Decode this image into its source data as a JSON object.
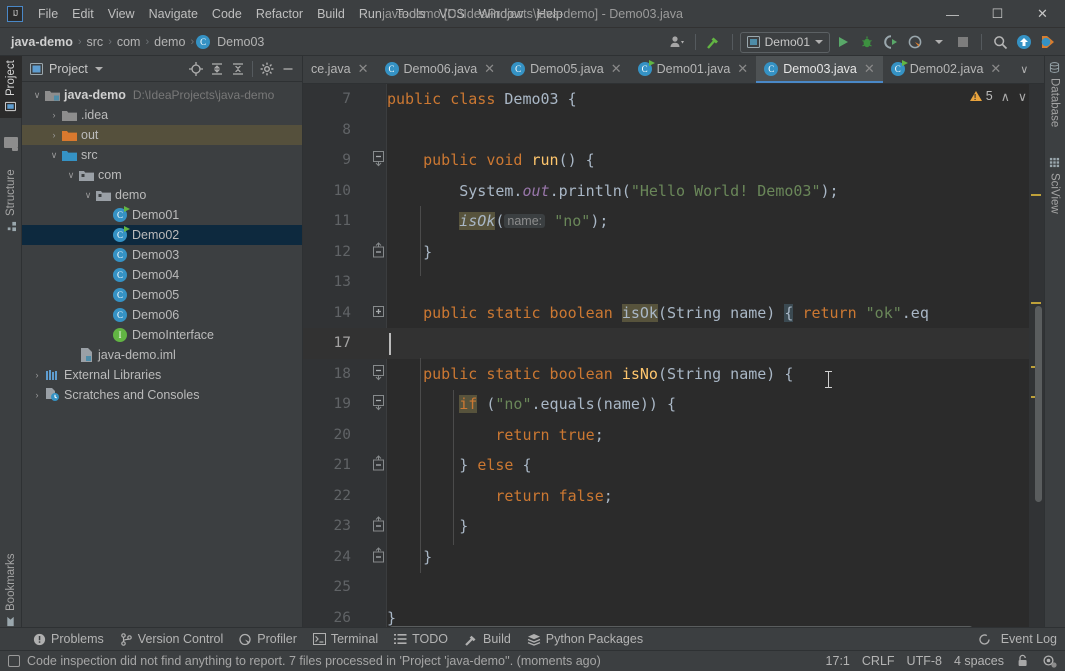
{
  "window": {
    "title": "java-demo [D:\\IdeaProjects\\java-demo] - Demo03.java",
    "logo": "intellij-idea-logo",
    "minimize": "—",
    "maximize": "☐",
    "close": "✕"
  },
  "menu": {
    "items": [
      "File",
      "Edit",
      "View",
      "Navigate",
      "Code",
      "Refactor",
      "Build",
      "Run",
      "Tools",
      "VCS",
      "Window",
      "Help"
    ]
  },
  "breadcrumb": {
    "items": [
      "java-demo",
      "src",
      "com",
      "demo",
      "Demo03"
    ],
    "separator": "›"
  },
  "toolbar": {
    "run_config": "Demo01",
    "icons": [
      "user-avatar-icon",
      "build-hammer-icon",
      "run-icon",
      "debug-icon",
      "run-with-coverage-icon",
      "profiler-icon",
      "stop-icon",
      "search-everywhere-icon",
      "update-project-icon",
      "git-push-icon"
    ]
  },
  "left_tool_strip": {
    "top": [
      {
        "label": "Project",
        "icon": "project-icon",
        "active": true
      },
      {
        "label": "Structure",
        "icon": "structure-icon",
        "active": false
      }
    ],
    "bottom": [
      {
        "label": "Bookmarks",
        "icon": "bookmark-icon",
        "active": false
      }
    ]
  },
  "right_tool_strip": {
    "items": [
      {
        "label": "Database",
        "icon": "database-icon"
      },
      {
        "label": "SciView",
        "icon": "sciview-icon"
      }
    ]
  },
  "project_panel": {
    "title": "Project",
    "tools": [
      "locate-icon",
      "expand-all-icon",
      "collapse-all-icon",
      "settings-gear-icon",
      "hide-panel-icon"
    ],
    "tree": [
      {
        "depth": 0,
        "twist": "∨",
        "icon": "module-folder-icon",
        "label": "java-demo",
        "sub": "D:\\IdeaProjects\\java-demo",
        "bold": true,
        "state": "normal"
      },
      {
        "depth": 1,
        "twist": "›",
        "icon": "folder-gray-icon",
        "label": ".idea",
        "sub": "",
        "bold": false,
        "state": "normal"
      },
      {
        "depth": 1,
        "twist": "›",
        "icon": "folder-orange-icon",
        "label": "out",
        "sub": "",
        "bold": false,
        "state": "highlight"
      },
      {
        "depth": 1,
        "twist": "∨",
        "icon": "folder-source-icon",
        "label": "src",
        "sub": "",
        "bold": false,
        "state": "normal"
      },
      {
        "depth": 2,
        "twist": "∨",
        "icon": "package-icon",
        "label": "com",
        "sub": "",
        "bold": false,
        "state": "normal"
      },
      {
        "depth": 3,
        "twist": "∨",
        "icon": "package-icon",
        "label": "demo",
        "sub": "",
        "bold": false,
        "state": "normal"
      },
      {
        "depth": 4,
        "twist": "",
        "icon": "java-class-runnable-icon",
        "label": "Demo01",
        "sub": "",
        "bold": false,
        "state": "normal"
      },
      {
        "depth": 4,
        "twist": "",
        "icon": "java-class-runnable-icon",
        "label": "Demo02",
        "sub": "",
        "bold": false,
        "state": "selected"
      },
      {
        "depth": 4,
        "twist": "",
        "icon": "java-class-icon",
        "label": "Demo03",
        "sub": "",
        "bold": false,
        "state": "normal"
      },
      {
        "depth": 4,
        "twist": "",
        "icon": "java-class-icon",
        "label": "Demo04",
        "sub": "",
        "bold": false,
        "state": "normal"
      },
      {
        "depth": 4,
        "twist": "",
        "icon": "java-class-icon",
        "label": "Demo05",
        "sub": "",
        "bold": false,
        "state": "normal"
      },
      {
        "depth": 4,
        "twist": "",
        "icon": "java-class-icon",
        "label": "Demo06",
        "sub": "",
        "bold": false,
        "state": "normal"
      },
      {
        "depth": 4,
        "twist": "",
        "icon": "java-interface-icon",
        "label": "DemoInterface",
        "sub": "",
        "bold": false,
        "state": "normal"
      },
      {
        "depth": 2,
        "twist": "",
        "icon": "iml-file-icon",
        "label": "java-demo.iml",
        "sub": "",
        "bold": false,
        "state": "normal"
      },
      {
        "depth": 0,
        "twist": "›",
        "icon": "external-libraries-icon",
        "label": "External Libraries",
        "sub": "",
        "bold": false,
        "state": "normal"
      },
      {
        "depth": 0,
        "twist": "›",
        "icon": "scratches-icon",
        "label": "Scratches and Consoles",
        "sub": "",
        "bold": false,
        "state": "normal"
      }
    ]
  },
  "editor_tabs": {
    "items": [
      {
        "label": "ce.java",
        "icon": "java-interface-icon",
        "active": false,
        "truncated": true
      },
      {
        "label": "Demo06.java",
        "icon": "java-class-icon",
        "active": false,
        "truncated": false
      },
      {
        "label": "Demo05.java",
        "icon": "java-class-icon",
        "active": false,
        "truncated": false
      },
      {
        "label": "Demo01.java",
        "icon": "java-class-runnable-icon",
        "active": false,
        "truncated": false
      },
      {
        "label": "Demo03.java",
        "icon": "java-class-icon",
        "active": true,
        "truncated": false
      },
      {
        "label": "Demo02.java",
        "icon": "java-class-runnable-icon",
        "active": false,
        "truncated": false
      }
    ],
    "close_glyph": "✕",
    "overflow_icon": "chevron-down-icon",
    "more_icon": "more-options-icon"
  },
  "editor": {
    "inspection_count": "5",
    "inspection_icon": "warning-triangle-icon",
    "prev_icon": "∧",
    "next_icon": "∨",
    "caret_position": "17:1",
    "lines": [
      {
        "num": "7",
        "fold": "",
        "current": false,
        "html": "<span class=\"kw\">public class</span> <span class=\"cls\">Demo03</span> {"
      },
      {
        "num": "8",
        "fold": "",
        "current": false,
        "html": ""
      },
      {
        "num": "9",
        "fold": "minus",
        "current": false,
        "html": "    <span class=\"kw\">public void</span> <span class=\"meth\">run</span>() {"
      },
      {
        "num": "10",
        "fold": "",
        "current": false,
        "html": "        System.<span class=\"fld\">out</span>.println(<span class=\"str\">\"Hello World! Demo03\"</span>);"
      },
      {
        "num": "11",
        "fold": "",
        "current": false,
        "html": "        <span class=\"usage-hl ident-it\">isOk</span>(<span class=\"hint\">name:</span> <span class=\"str\">\"no\"</span>);"
      },
      {
        "num": "12",
        "fold": "end",
        "current": false,
        "html": "    }"
      },
      {
        "num": "13",
        "fold": "",
        "current": false,
        "html": ""
      },
      {
        "num": "14",
        "fold": "plus",
        "current": false,
        "html": "    <span class=\"kw\">public static boolean</span> <span class=\"usage-hl\">isOk</span>(<span class=\"cls\">String</span> name) <span class=\"brace-hl\">{</span> <span class=\"kw\">return</span> <span class=\"str\">\"ok\"</span>.eq"
      },
      {
        "num": "17",
        "fold": "",
        "current": true,
        "html": ""
      },
      {
        "num": "18",
        "fold": "minus",
        "current": false,
        "html": "    <span class=\"kw\">public static boolean</span> <span class=\"meth\">isNo</span>(<span class=\"cls\">String</span> name) {"
      },
      {
        "num": "19",
        "fold": "minus",
        "current": false,
        "html": "        <span class=\"usage-hl\"><span class=\"kw\">if</span></span> (<span class=\"str\">\"no\"</span>.equals(name)) {"
      },
      {
        "num": "20",
        "fold": "",
        "current": false,
        "html": "            <span class=\"kw\">return true</span>;"
      },
      {
        "num": "21",
        "fold": "end",
        "current": false,
        "html": "        } <span class=\"kw\">else</span> {"
      },
      {
        "num": "22",
        "fold": "",
        "current": false,
        "html": "            <span class=\"kw\">return false</span>;"
      },
      {
        "num": "23",
        "fold": "end",
        "current": false,
        "html": "        }"
      },
      {
        "num": "24",
        "fold": "end",
        "current": false,
        "html": "    }"
      },
      {
        "num": "25",
        "fold": "",
        "current": false,
        "html": ""
      },
      {
        "num": "26",
        "fold": "",
        "current": false,
        "html": "}"
      }
    ]
  },
  "tool_windows": {
    "items": [
      {
        "label": "Problems",
        "icon": "problems-icon"
      },
      {
        "label": "Version Control",
        "icon": "version-control-icon"
      },
      {
        "label": "Profiler",
        "icon": "profiler-icon"
      },
      {
        "label": "Terminal",
        "icon": "terminal-icon"
      },
      {
        "label": "TODO",
        "icon": "todo-icon"
      },
      {
        "label": "Build",
        "icon": "build-hammer-icon"
      },
      {
        "label": "Python Packages",
        "icon": "python-packages-icon"
      }
    ],
    "event_log": {
      "label": "Event Log",
      "icon": "event-log-icon"
    }
  },
  "status_bar": {
    "message": "Code inspection did not find anything to report. 7 files processed in 'Project 'java-demo''. (moments ago)",
    "message_icon": "inspection-status-icon",
    "position": "17:1",
    "line_separator": "CRLF",
    "encoding": "UTF-8",
    "indent": "4 spaces",
    "lock_icon": "read-write-lock-icon",
    "inspection_level_icon": "inspection-eye-icon"
  },
  "colors": {
    "accent": "#4a88c7",
    "background": "#3c3f41",
    "editor_bg": "#2b2b2b",
    "selection": "#0d293e",
    "warning": "#e8a33d",
    "keyword": "#cc7832",
    "string": "#6a8759",
    "run_green": "#62b543"
  }
}
